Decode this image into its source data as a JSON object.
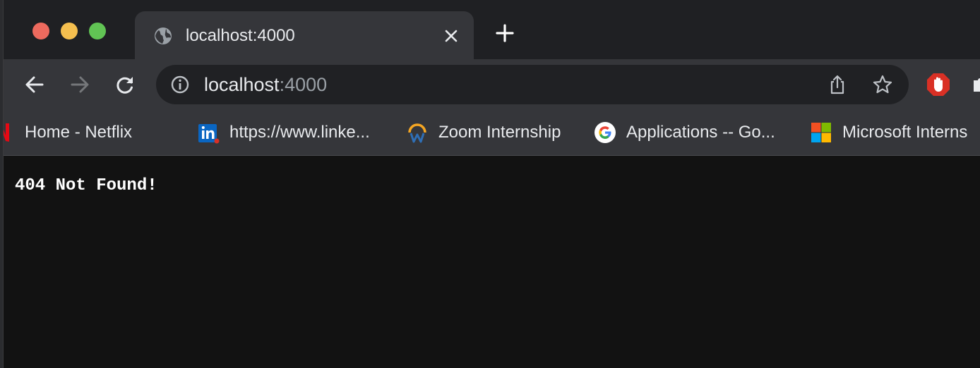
{
  "window": {
    "tab": {
      "title": "localhost:4000",
      "icon": "globe-icon"
    },
    "new_tab_icon": "plus-icon"
  },
  "toolbar": {
    "back_icon": "arrow-left-icon",
    "forward_icon": "arrow-right-icon",
    "reload_icon": "reload-icon",
    "address": {
      "host": "localhost",
      "port": ":4000"
    },
    "share_icon": "share-icon",
    "bookmark_star_icon": "star-icon",
    "extensions": [
      "adblock-hand-icon",
      "puzzle-icon"
    ]
  },
  "bookmarks": [
    {
      "label": "Home - Netflix",
      "icon": "netflix-icon",
      "color": "#e50914"
    },
    {
      "label": "https://www.linke...",
      "icon": "linkedin-icon",
      "color": "#0a66c2"
    },
    {
      "label": "Zoom Internship",
      "icon": "workday-icon",
      "color": "#f5a623"
    },
    {
      "label": "Applications -- Go...",
      "icon": "google-icon",
      "color": "#4285f4"
    },
    {
      "label": "Microsoft Interns",
      "icon": "microsoft-icon",
      "color": "#f25022"
    }
  ],
  "page": {
    "message": "404 Not Found!"
  }
}
